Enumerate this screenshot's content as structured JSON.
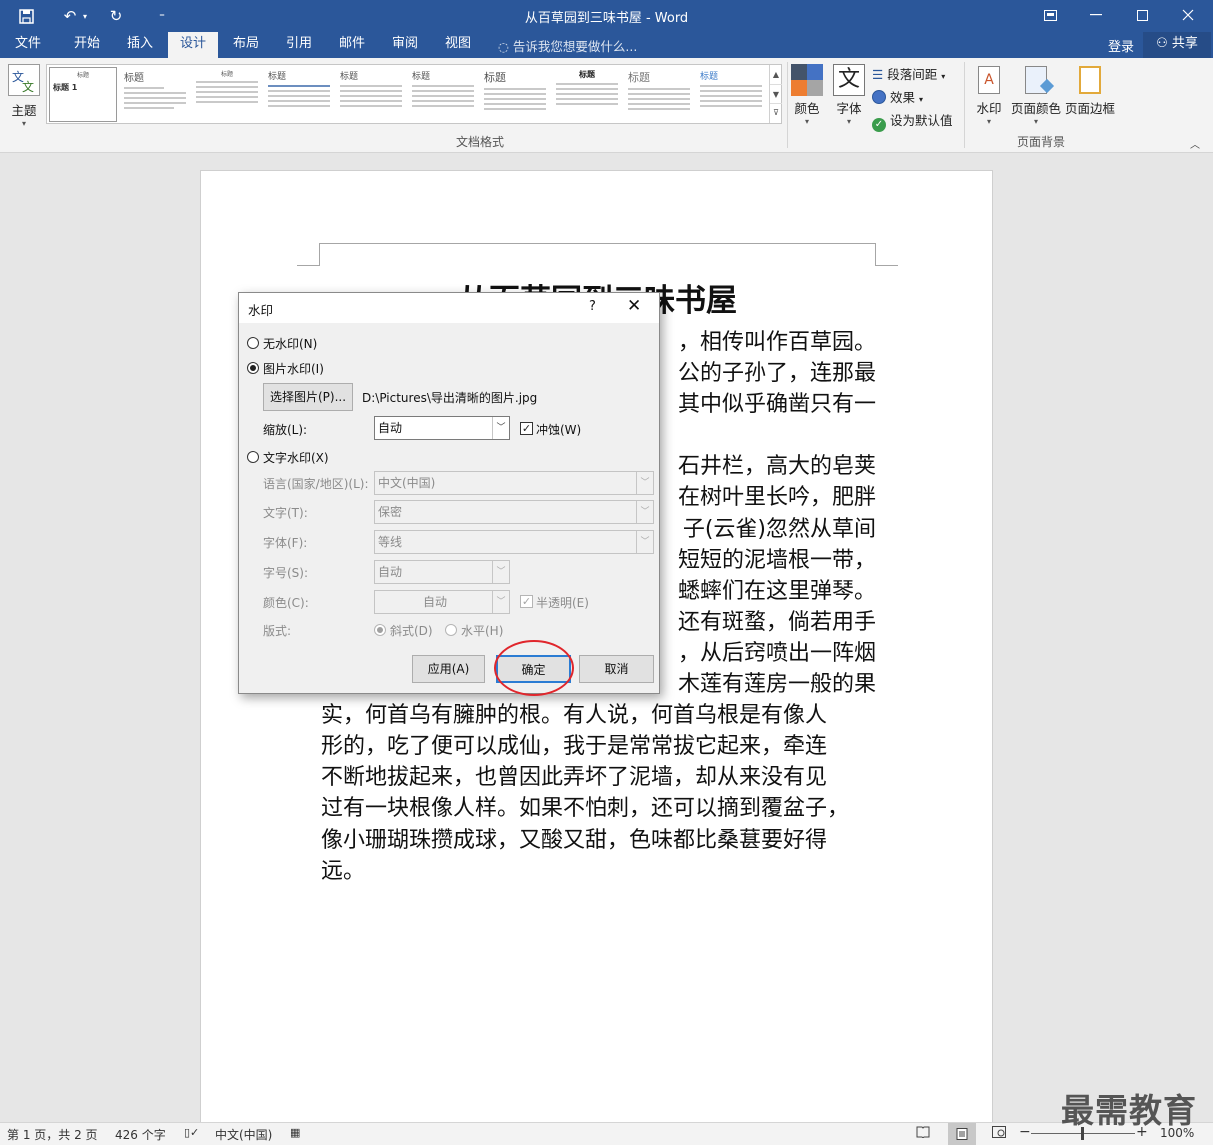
{
  "window": {
    "title": "从百草园到三味书屋 - Word",
    "quick_access": {
      "customize": "⁼"
    }
  },
  "menu": {
    "tabs": [
      "文件",
      "开始",
      "插入",
      "设计",
      "布局",
      "引用",
      "邮件",
      "审阅",
      "视图"
    ],
    "active_tab": "设计",
    "tell_me": "告诉我您想要做什么...",
    "login": "登录",
    "share": "共享"
  },
  "ribbon": {
    "theme_label": "主题",
    "gallery_group_label": "文档格式",
    "gallery_items": [
      "标题 1",
      "标题",
      "标题",
      "标题",
      "标题",
      "标题",
      "标题",
      "标题",
      "标题",
      "标题"
    ],
    "colors_label": "颜色",
    "fonts_label": "字体",
    "paragraph_spacing": "段落间距",
    "effects": "效果",
    "set_default": "设为默认值",
    "watermark": "水印",
    "page_color": "页面颜色",
    "page_borders": "页面边框",
    "page_background_group": "页面背景"
  },
  "document": {
    "title": "从百草园到三味书屋",
    "lines": [
      "，相传叫作百草园。",
      "公的子孙了，连那最",
      "其中似乎确凿只有一",
      "",
      "石井栏，高大的皂荚",
      "在树叶里长吟，肥胖",
      "子(云雀)忽然从草间",
      "短短的泥墙根一带，",
      "蟋蟀们在这里弹琴。",
      "还有斑蝥，倘若用手",
      "，从后窍喷出一阵烟",
      "木莲有莲房一般的果",
      "实，何首乌有臃肿的根。有人说，何首乌根是有像人",
      "形的，吃了便可以成仙，我于是常常拔它起来，牵连",
      "不断地拔起来，也曾因此弄坏了泥墙，却从来没有见",
      "过有一块根像人样。如果不怕刺，还可以摘到覆盆子，",
      "像小珊瑚珠攒成球，又酸又甜，色味都比桑葚要好得",
      "远。"
    ]
  },
  "dialog": {
    "title": "水印",
    "help": "?",
    "close": "✕",
    "no_watermark": "无水印(N)",
    "picture_watermark": "图片水印(I)",
    "select_picture_btn": "选择图片(P)...",
    "picture_path": "D:\\Pictures\\导出清晰的图片.jpg",
    "scale_label": "缩放(L):",
    "scale_value": "自动",
    "washout_label": "冲蚀(W)",
    "text_watermark": "文字水印(X)",
    "language_label": "语言(国家/地区)(L):",
    "language_value": "中文(中国)",
    "text_label": "文字(T):",
    "text_value": "保密",
    "font_label": "字体(F):",
    "font_value": "等线",
    "size_label": "字号(S):",
    "size_value": "自动",
    "color_label": "颜色(C):",
    "color_value": "自动",
    "semitransparent_label": "半透明(E)",
    "layout_label": "版式:",
    "diagonal_label": "斜式(D)",
    "horizontal_label": "水平(H)",
    "apply_btn": "应用(A)",
    "ok_btn": "确定",
    "cancel_btn": "取消",
    "selected_mode": "picture",
    "washout_checked": true,
    "semitransparent_checked": true
  },
  "status": {
    "page": "第 1 页，共 2 页",
    "words": "426 个字",
    "language": "中文(中国)",
    "zoom": "100%",
    "minus": "−",
    "plus": "+"
  },
  "watermark_brand": "最需教育",
  "colors": {
    "word_blue": "#2b579a",
    "highlight_ring": "#e0262c",
    "default_button_border": "#2b7cd3"
  }
}
